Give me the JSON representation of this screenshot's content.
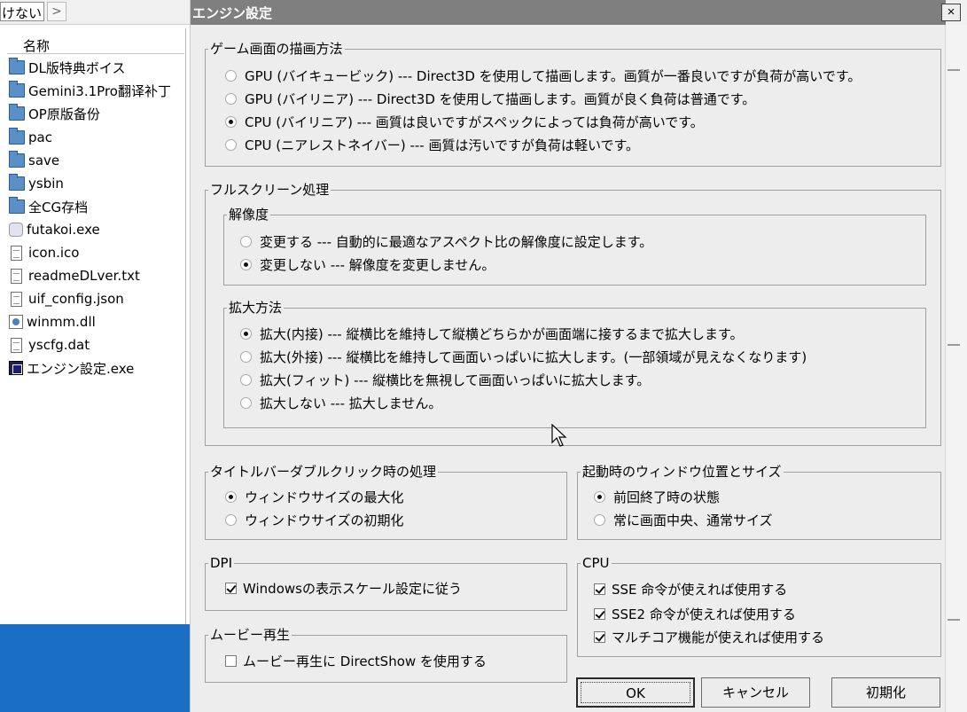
{
  "explorer": {
    "address_text": "けない",
    "next_glyph": ">",
    "column_name": "名称",
    "files": [
      {
        "name": "DL版特典ボイス",
        "icon": "folder-icon"
      },
      {
        "name": "Gemini3.1Pro翻译补丁",
        "icon": "folder-icon"
      },
      {
        "name": "OP原版备份",
        "icon": "folder-icon"
      },
      {
        "name": "pac",
        "icon": "folder-icon"
      },
      {
        "name": "save",
        "icon": "folder-icon"
      },
      {
        "name": "ysbin",
        "icon": "folder-icon"
      },
      {
        "name": "全CG存档",
        "icon": "folder-icon"
      },
      {
        "name": "futakoi.exe",
        "icon": "app-icon"
      },
      {
        "name": "icon.ico",
        "icon": "document-icon"
      },
      {
        "name": "readmeDLver.txt",
        "icon": "document-icon"
      },
      {
        "name": "uif_config.json",
        "icon": "document-icon"
      },
      {
        "name": "winmm.dll",
        "icon": "dll-icon"
      },
      {
        "name": "yscfg.dat",
        "icon": "document-icon"
      },
      {
        "name": "エンジン設定.exe",
        "icon": "settings-app-icon"
      }
    ]
  },
  "dialog": {
    "title": "エンジン設定",
    "close_glyph": "×",
    "render_group": {
      "legend": "ゲーム画面の描画方法",
      "options": [
        {
          "label": "GPU (バイキュービック) --- Direct3D を使用して描画します。画質が一番良いですが負荷が高いです。",
          "checked": false
        },
        {
          "label": "GPU (バイリニア) --- Direct3D を使用して描画します。画質が良く負荷は普通です。",
          "checked": false
        },
        {
          "label": "CPU (バイリニア) --- 画質は良いですがスペックによっては負荷が高いです。",
          "checked": true
        },
        {
          "label": "CPU (ニアレストネイバー) --- 画質は汚いですが負荷は軽いです。",
          "checked": false
        }
      ]
    },
    "fullscreen_group": {
      "legend": "フルスクリーン処理",
      "resolution": {
        "legend": "解像度",
        "options": [
          {
            "label": "変更する --- 自動的に最適なアスペクト比の解像度に設定します。",
            "checked": false
          },
          {
            "label": "変更しない --- 解像度を変更しません。",
            "checked": true
          }
        ]
      },
      "scaling": {
        "legend": "拡大方法",
        "options": [
          {
            "label": "拡大(内接) --- 縦横比を維持して縦横どちらかが画面端に接するまで拡大します。",
            "checked": true
          },
          {
            "label": "拡大(外接) --- 縦横比を維持して画面いっぱいに拡大します。(一部領域が見えなくなります)",
            "checked": false
          },
          {
            "label": "拡大(フィット) --- 縦横比を無視して画面いっぱいに拡大します。",
            "checked": false
          },
          {
            "label": "拡大しない --- 拡大しません。",
            "checked": false
          }
        ]
      }
    },
    "titlebar_group": {
      "legend": "タイトルバーダブルクリック時の処理",
      "options": [
        {
          "label": "ウィンドウサイズの最大化",
          "checked": true
        },
        {
          "label": "ウィンドウサイズの初期化",
          "checked": false
        }
      ]
    },
    "startup_group": {
      "legend": "起動時のウィンドウ位置とサイズ",
      "options": [
        {
          "label": "前回終了時の状態",
          "checked": true
        },
        {
          "label": "常に画面中央、通常サイズ",
          "checked": false
        }
      ]
    },
    "dpi_group": {
      "legend": "DPI",
      "options": [
        {
          "label": "Windowsの表示スケール設定に従う",
          "checked": true
        }
      ]
    },
    "cpu_group": {
      "legend": "CPU",
      "options": [
        {
          "label": "SSE 命令が使えれば使用する",
          "checked": true
        },
        {
          "label": "SSE2 命令が使えれば使用する",
          "checked": true
        },
        {
          "label": "マルチコア機能が使えれば使用する",
          "checked": true
        }
      ]
    },
    "movie_group": {
      "legend": "ムービー再生",
      "options": [
        {
          "label": "ムービー再生に DirectShow を使用する",
          "checked": false
        }
      ]
    },
    "buttons": {
      "ok": "OK",
      "cancel": "キャンセル",
      "reset": "初期化"
    }
  }
}
